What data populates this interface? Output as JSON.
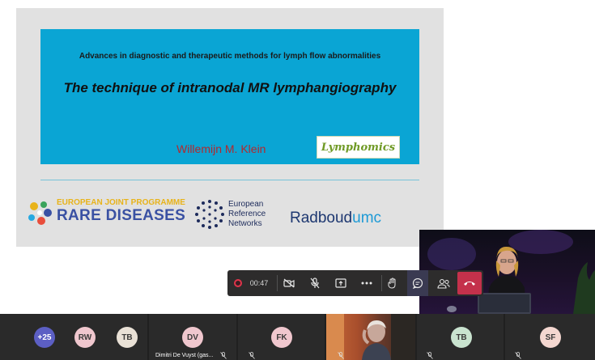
{
  "slide": {
    "subtitle": "Advances in diagnostic and therapeutic methods for lymph flow abnormalities",
    "title": "The technique of intranodal MR lymphangiography",
    "author": "Willemijn M. Klein",
    "lymphomics_logo": "Lymphomics",
    "ejp_top": "EUROPEAN JOINT PROGRAMME",
    "ejp_bottom": "RARE DISEASES",
    "ern_lines": [
      "European",
      "Reference",
      "Networks"
    ],
    "radboud": "Radboud",
    "umc": "umc",
    "colors": {
      "title_bg": "#0aa5d4",
      "author": "#b3282d",
      "ejp_blue": "#3a51a3",
      "ejp_yellow": "#e8b31a"
    }
  },
  "controls": {
    "timer": "00:47",
    "icons": [
      "record-icon",
      "camera-off-icon",
      "mic-off-icon",
      "share-screen-icon",
      "more-icon",
      "raise-hand-icon",
      "chat-icon",
      "participants-icon",
      "hang-up-icon"
    ],
    "hangup_color": "#c4314b"
  },
  "participants": {
    "more_count": "+25",
    "tiles": [
      {
        "initials": "RW",
        "color": "#f0c7ce"
      },
      {
        "initials": "TB",
        "color": "#e9e1d6"
      },
      {
        "initials": "DV",
        "color": "#f0c7ce"
      },
      {
        "initials": "FK",
        "color": "#f0c7ce"
      },
      {
        "initials": "TB",
        "color": "#c9e3cf"
      },
      {
        "initials": "SF",
        "color": "#f4d7d0"
      }
    ],
    "name_label": "Dimitri De Vuyst (gas..."
  }
}
